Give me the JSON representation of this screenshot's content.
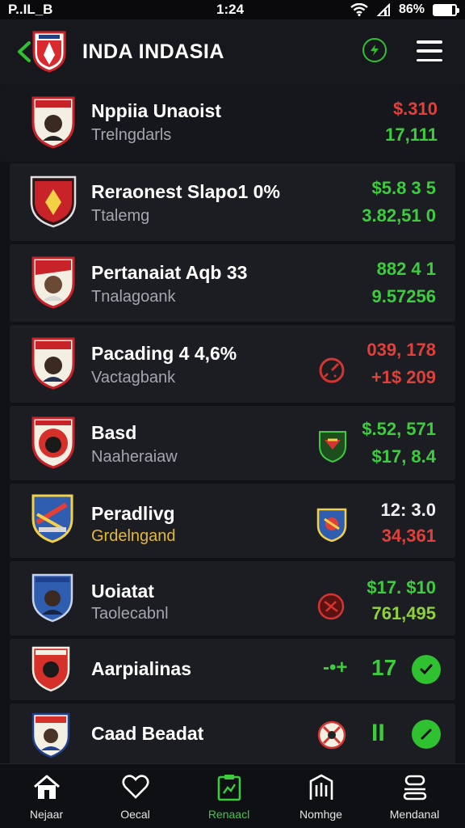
{
  "status_bar": {
    "left": "P..IL_B",
    "time": "1:24",
    "battery": "86%",
    "battery_level": 0.86
  },
  "header": {
    "title": "INDA INDASIA"
  },
  "rows": [
    {
      "name": "Nppiia Unaoist",
      "sub": "Trelngdarls",
      "value1": "$.310",
      "value2": "17,111",
      "colors": [
        "red",
        "green"
      ]
    },
    {
      "name": "Reraonest Slapo1 0%",
      "sub": "Ttalemg",
      "value1": "$5.8 3 5",
      "value2": "3.82,51 0",
      "colors": [
        "green",
        "green"
      ]
    },
    {
      "name": "Pertanaiat Aqb 33",
      "sub": "Tnalagoank",
      "value1": "882 4 1",
      "value2": "9.57256",
      "colors": [
        "green",
        "green"
      ]
    },
    {
      "name": "Pacading 4 4,6%",
      "sub": "Vactagbank",
      "value1": "039, 178",
      "value2": "+1$ 209",
      "colors": [
        "red",
        "red"
      ]
    },
    {
      "name": "Basd",
      "sub": "Naaheraiaw",
      "value1": "$.52, 571",
      "value2": "$17, 8.4",
      "colors": [
        "green",
        "green"
      ]
    },
    {
      "name": "Peradlivg",
      "sub": "Grdelngand",
      "value1": "12: 3.0",
      "value2": "34,361",
      "colors": [
        "white",
        "red"
      ]
    },
    {
      "name": "Uoiatat",
      "sub": "Taolecabnl",
      "value1": "$17. $10",
      "value2": "761,495",
      "colors": [
        "green",
        "green"
      ]
    },
    {
      "name": "Aarpialinas",
      "sub": "",
      "mark": "-•+",
      "value1": "17",
      "value2": "",
      "colors": [
        "green",
        "green"
      ]
    },
    {
      "name": "Caad Beadat",
      "sub": "",
      "mark": "",
      "value1": "II",
      "value2": "",
      "colors": [
        "green",
        "green"
      ]
    }
  ],
  "nav": [
    {
      "label": "Nejaar"
    },
    {
      "label": "Oecal"
    },
    {
      "label": "Renaacl"
    },
    {
      "label": "Nomhge"
    },
    {
      "label": "Mendanal"
    }
  ],
  "colors": {
    "accent": "#2fc12f",
    "negative": "#e1403a",
    "background": "#111217",
    "row": "#1c1d23"
  },
  "icons": {
    "row3": "stopwatch-icon",
    "row4": "shield-crest-icon",
    "row5": "shield-badge-icon",
    "row6": "splash-crest-icon",
    "row8": "sports-icon"
  }
}
